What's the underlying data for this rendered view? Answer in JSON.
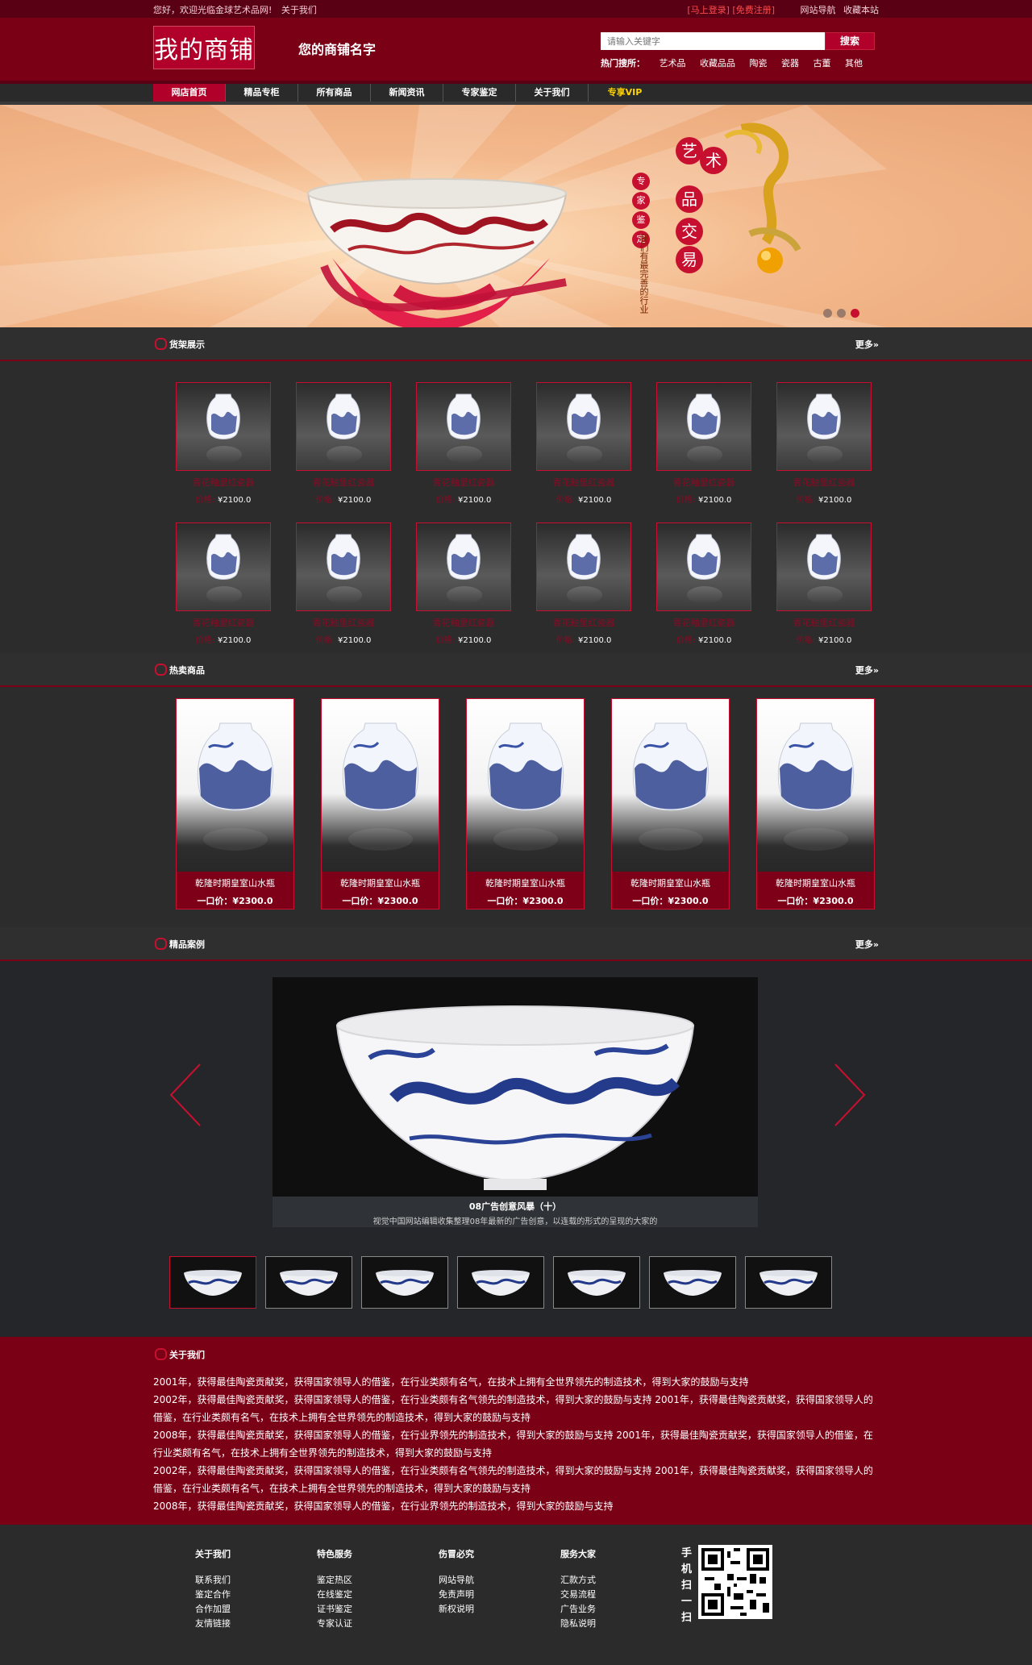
{
  "topbar": {
    "welcome": "您好，欢迎光临金球艺术品网!",
    "about": "关于我们",
    "login": "[马上登录] [免费注册]",
    "site_nav": "网站导航",
    "favorite": "收藏本站"
  },
  "header": {
    "logo": "我的商铺",
    "shop_name": "您的商铺名字",
    "search_placeholder": "请输入关键字",
    "search_button": "搜索",
    "hot_label": "热门搜所：",
    "hot_items": [
      "艺术品",
      "收藏品品",
      "陶瓷",
      "瓷器",
      "古董",
      "其他"
    ]
  },
  "nav": {
    "items": [
      "网店首页",
      "精品专柜",
      "所有商品",
      "新闻资讯",
      "专家鉴定",
      "关于我们",
      "专享VIP"
    ]
  },
  "banner": {
    "badges": [
      "专",
      "家",
      "鉴",
      "定"
    ],
    "big_badges": [
      "艺",
      "术",
      "品",
      "交",
      "易"
    ],
    "vertical_text": "我们有最完善的行业"
  },
  "shelf": {
    "title": "货架展示",
    "more": "更多»",
    "price_label": "价格:",
    "items": [
      {
        "name": "青花釉里红瓷器",
        "price": "¥2100.0"
      },
      {
        "name": "青花釉里红瓷器",
        "price": "¥2100.0"
      },
      {
        "name": "青花釉里红瓷器",
        "price": "¥2100.0"
      },
      {
        "name": "青花釉里红瓷器",
        "price": "¥2100.0"
      },
      {
        "name": "青花釉里红瓷器",
        "price": "¥2100.0"
      },
      {
        "name": "青花釉里红瓷器",
        "price": "¥2100.0"
      },
      {
        "name": "青花釉里红瓷器",
        "price": "¥2100.0"
      },
      {
        "name": "青花釉里红瓷器",
        "price": "¥2100.0"
      },
      {
        "name": "青花釉里红瓷器",
        "price": "¥2100.0"
      },
      {
        "name": "青花釉里红瓷器",
        "price": "¥2100.0"
      },
      {
        "name": "青花釉里红瓷器",
        "price": "¥2100.0"
      },
      {
        "name": "青花釉里红瓷器",
        "price": "¥2100.0"
      }
    ]
  },
  "hotsale": {
    "title": "热卖商品",
    "more": "更多»",
    "items": [
      {
        "name": "乾隆时期皇室山水瓶",
        "price": "一口价：¥2300.0"
      },
      {
        "name": "乾隆时期皇室山水瓶",
        "price": "一口价：¥2300.0"
      },
      {
        "name": "乾隆时期皇室山水瓶",
        "price": "一口价：¥2300.0"
      },
      {
        "name": "乾隆时期皇室山水瓶",
        "price": "一口价：¥2300.0"
      },
      {
        "name": "乾隆时期皇室山水瓶",
        "price": "一口价：¥2300.0"
      }
    ]
  },
  "cases": {
    "title": "精品案例",
    "more": "更多»",
    "caption_title": "08广告创意风暴（十）",
    "caption_desc": "视觉中国网站编辑收集整理08年最新的广告创意，以连载的形式的呈现的大家的"
  },
  "about": {
    "title": "关于我们",
    "paragraphs": [
      "2001年，获得最佳陶瓷贡献奖，获得国家领导人的借鉴，在行业类颇有名气，在技术上拥有全世界领先的制造技术，得到大家的鼓励与支持",
      "2002年，获得最佳陶瓷贡献奖，获得国家领导人的借鉴，在行业类颇有名气领先的制造技术，得到大家的鼓励与支持 2001年，获得最佳陶瓷贡献奖，获得国家领导人的借鉴，在行业类颇有名气，在技术上拥有全世界领先的制造技术，得到大家的鼓励与支持",
      "2008年，获得最佳陶瓷贡献奖，获得国家领导人的借鉴，在行业界领先的制造技术，得到大家的鼓励与支持 2001年，获得最佳陶瓷贡献奖，获得国家领导人的借鉴，在行业类颇有名气，在技术上拥有全世界领先的制造技术，得到大家的鼓励与支持",
      "2002年，获得最佳陶瓷贡献奖，获得国家领导人的借鉴，在行业类颇有名气领先的制造技术，得到大家的鼓励与支持 2001年，获得最佳陶瓷贡献奖，获得国家领导人的借鉴，在行业类颇有名气，在技术上拥有全世界领先的制造技术，得到大家的鼓励与支持",
      "2008年，获得最佳陶瓷贡献奖，获得国家领导人的借鉴，在行业界领先的制造技术，得到大家的鼓励与支持"
    ]
  },
  "footer": {
    "columns": [
      {
        "heading": "关于我们",
        "links": [
          "联系我们",
          "鉴定合作",
          "合作加盟",
          "友情链接"
        ]
      },
      {
        "heading": "特色服务",
        "links": [
          "鉴定热区",
          "在线鉴定",
          "证书鉴定",
          "专家认证"
        ]
      },
      {
        "heading": "伤冒必究",
        "links": [
          "网站导航",
          "免责声明",
          "新权说明"
        ]
      },
      {
        "heading": "服务大家",
        "links": [
          "汇款方式",
          "交易流程",
          "广告业务",
          "隐私说明"
        ]
      }
    ],
    "qr_label": "手机扫一扫"
  },
  "colors": {
    "brand": "#7a0016",
    "accent": "#c7102f",
    "dark": "#2b2b2b"
  }
}
